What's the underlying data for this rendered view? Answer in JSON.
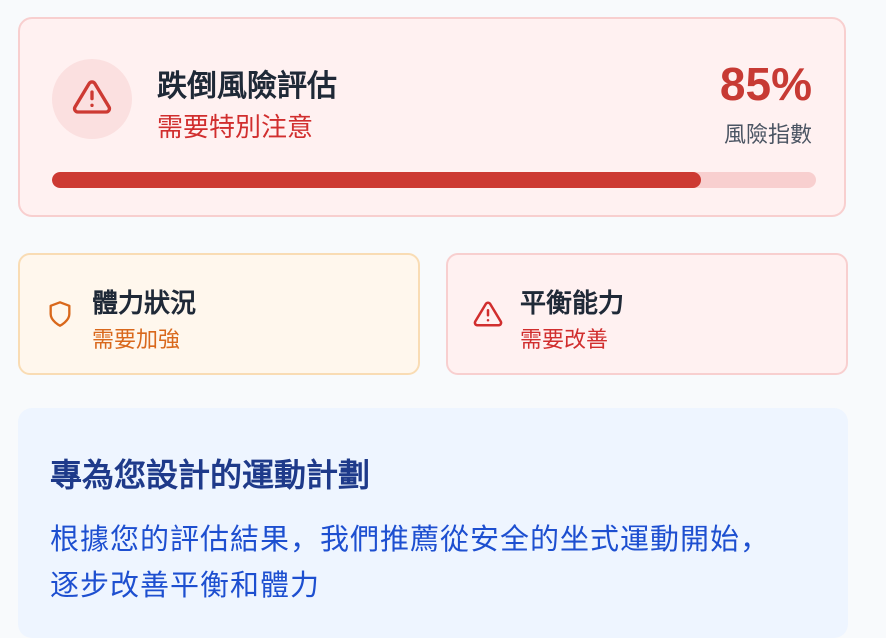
{
  "risk": {
    "title": "跌倒風險評估",
    "status": "需要特別注意",
    "percent_text": "85%",
    "index_label": "風險指數",
    "progress_fraction": 0.85,
    "icon": "warning-triangle-icon",
    "colors": {
      "accent": "#c73a34",
      "background": "#fff1f1",
      "track": "#f8cfcf"
    }
  },
  "cards": {
    "fitness": {
      "title": "體力狀況",
      "status": "需要加強",
      "icon": "shield-icon",
      "color": "#d9681c"
    },
    "balance": {
      "title": "平衡能力",
      "status": "需要改善",
      "icon": "warning-triangle-icon",
      "color": "#d12e2e"
    }
  },
  "plan": {
    "title": "專為您設計的運動計劃",
    "description": "根據您的評估結果，我們推薦從安全的坐式運動開始，逐步改善平衡和體力",
    "colors": {
      "title": "#1e3a8a",
      "text": "#1d4fd0",
      "background": "#eef5ff"
    }
  }
}
